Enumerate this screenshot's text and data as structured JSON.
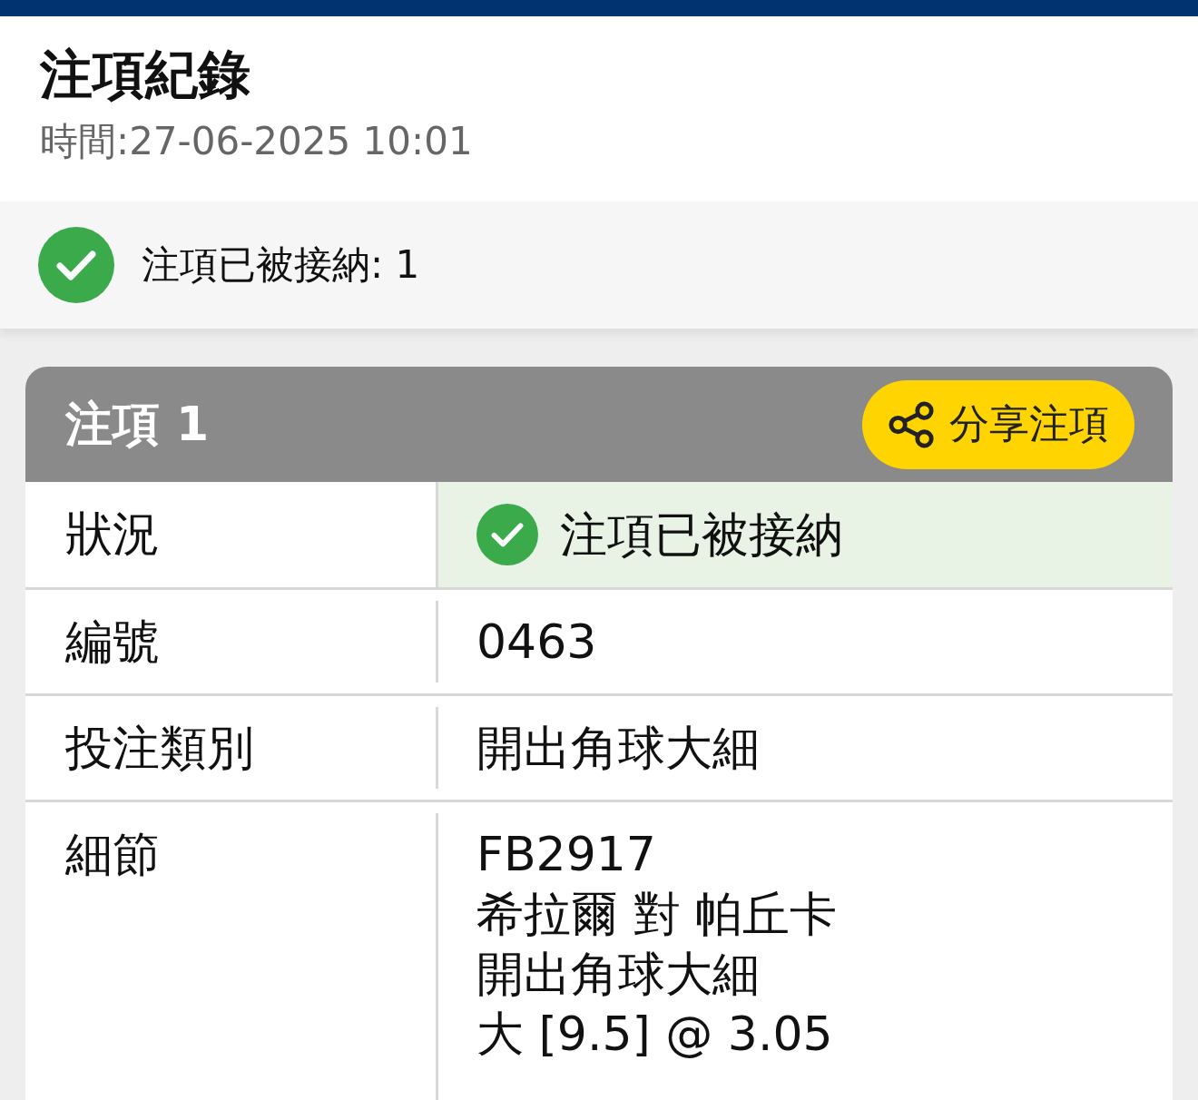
{
  "header": {
    "title": "注項紀錄",
    "time": "時間:27-06-2025 10:01"
  },
  "banner": {
    "accepted": true,
    "text": "注項已被接納: 1"
  },
  "bets": [
    {
      "title": "注項 1",
      "share_button": "分享注項",
      "rows": [
        {
          "label": "狀況",
          "kind": "status",
          "accepted": true,
          "value": "注項已被接納"
        },
        {
          "label": "編號",
          "kind": "text",
          "lines": [
            "0463"
          ]
        },
        {
          "label": "投注類別",
          "kind": "text",
          "lines": [
            "開出角球大細"
          ]
        },
        {
          "label": "細節",
          "kind": "text",
          "lines": [
            "FB2917",
            "希拉爾 對 帕丘卡",
            "開出角球大細",
            "大 [9.5] @ 3.05"
          ]
        }
      ]
    }
  ]
}
